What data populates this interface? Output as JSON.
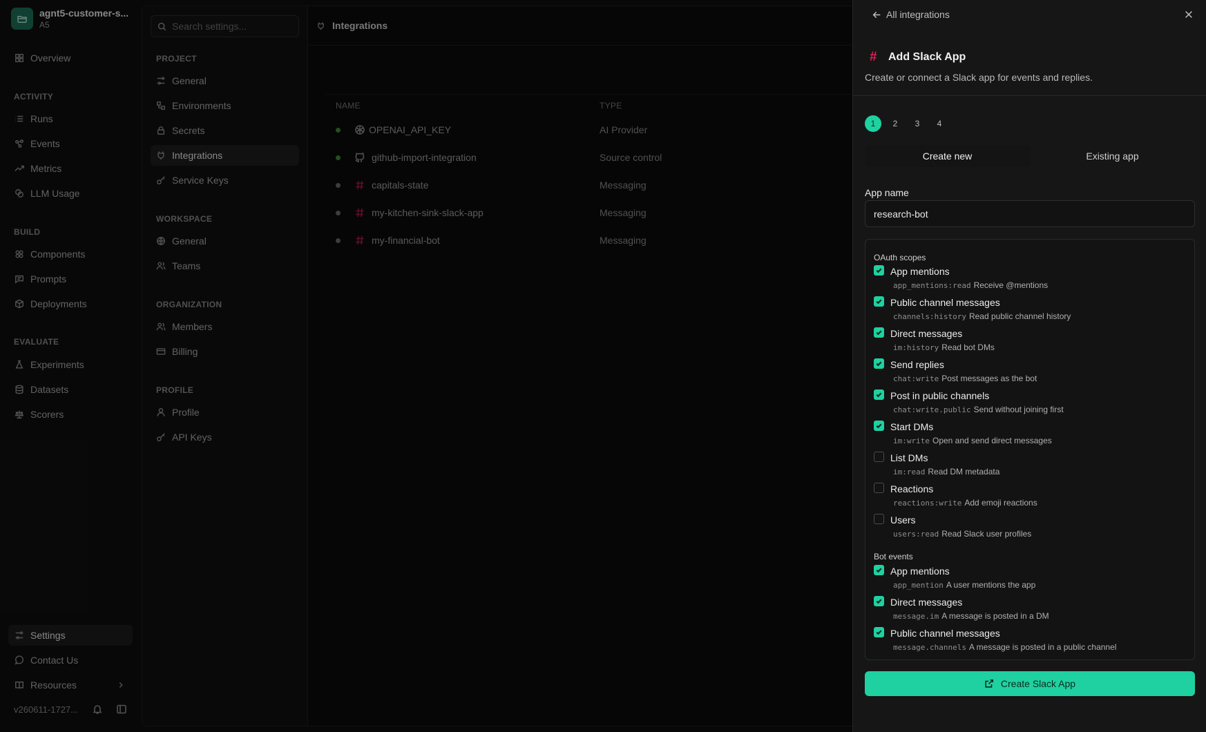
{
  "workspace": {
    "name": "agnt5-customer-s...",
    "org": "A5"
  },
  "app_nav": {
    "overview": "Overview",
    "sections": {
      "activity": "ACTIVITY",
      "build": "BUILD",
      "evaluate": "EVALUATE"
    },
    "activity": [
      "Runs",
      "Events",
      "Metrics",
      "LLM Usage"
    ],
    "build": [
      "Components",
      "Prompts",
      "Deployments"
    ],
    "evaluate": [
      "Experiments",
      "Datasets",
      "Scorers"
    ],
    "footer": {
      "settings": "Settings",
      "contact": "Contact Us",
      "resources": "Resources",
      "version": "v260611-1727..."
    }
  },
  "settings_nav": {
    "search_placeholder": "Search settings...",
    "sections": {
      "project": "PROJECT",
      "workspace": "WORKSPACE",
      "organization": "ORGANIZATION",
      "profile": "PROFILE"
    },
    "project": [
      "General",
      "Environments",
      "Secrets",
      "Integrations",
      "Service Keys"
    ],
    "workspace": [
      "General",
      "Teams"
    ],
    "organization": [
      "Members",
      "Billing"
    ],
    "profile": [
      "Profile",
      "API Keys"
    ]
  },
  "content": {
    "title": "Integrations",
    "columns": {
      "name": "NAME",
      "type": "TYPE"
    },
    "rows": [
      {
        "name": "OPENAI_API_KEY",
        "type": "AI Provider",
        "status_color": "#3a8a3a",
        "icon": "openai-icon"
      },
      {
        "name": "github-import-integration",
        "type": "Source control",
        "status_color": "#3a8a3a",
        "icon": "github-icon"
      },
      {
        "name": "capitals-state",
        "type": "Messaging",
        "status_color": "#6a6a6a",
        "icon": "slack-hash-icon"
      },
      {
        "name": "my-kitchen-sink-slack-app",
        "type": "Messaging",
        "status_color": "#6a6a6a",
        "icon": "slack-hash-icon"
      },
      {
        "name": "my-financial-bot",
        "type": "Messaging",
        "status_color": "#6a6a6a",
        "icon": "slack-hash-icon"
      }
    ]
  },
  "drawer": {
    "back_label": "All integrations",
    "hash_glyph": "#",
    "title": "Add Slack App",
    "description": "Create or connect a Slack app for events and replies.",
    "steps": [
      "1",
      "2",
      "3",
      "4"
    ],
    "tabs": {
      "create_new": "Create new",
      "existing": "Existing app"
    },
    "app_name_label": "App name",
    "app_name_value": "research-bot",
    "oauth_title": "OAuth scopes",
    "oauth_scopes": [
      {
        "label": "App mentions",
        "code": "app_mentions:read",
        "desc": "Receive @mentions",
        "checked": true
      },
      {
        "label": "Public channel messages",
        "code": "channels:history",
        "desc": "Read public channel history",
        "checked": true
      },
      {
        "label": "Direct messages",
        "code": "im:history",
        "desc": "Read bot DMs",
        "checked": true
      },
      {
        "label": "Send replies",
        "code": "chat:write",
        "desc": "Post messages as the bot",
        "checked": true
      },
      {
        "label": "Post in public channels",
        "code": "chat:write.public",
        "desc": "Send without joining first",
        "checked": true
      },
      {
        "label": "Start DMs",
        "code": "im:write",
        "desc": "Open and send direct messages",
        "checked": true
      },
      {
        "label": "List DMs",
        "code": "im:read",
        "desc": "Read DM metadata",
        "checked": false
      },
      {
        "label": "Reactions",
        "code": "reactions:write",
        "desc": "Add emoji reactions",
        "checked": false
      },
      {
        "label": "Users",
        "code": "users:read",
        "desc": "Read Slack user profiles",
        "checked": false
      }
    ],
    "events_title": "Bot events",
    "bot_events": [
      {
        "label": "App mentions",
        "code": "app_mention",
        "desc": "A user mentions the app",
        "checked": true
      },
      {
        "label": "Direct messages",
        "code": "message.im",
        "desc": "A message is posted in a DM",
        "checked": true
      },
      {
        "label": "Public channel messages",
        "code": "message.channels",
        "desc": "A message is posted in a public channel",
        "checked": true
      }
    ],
    "create_button": "Create Slack App"
  },
  "colors": {
    "accent": "#1fd1a0",
    "slack": "#e01e5a",
    "status_active": "#3a8a3a",
    "status_idle": "#6a6a6a"
  }
}
